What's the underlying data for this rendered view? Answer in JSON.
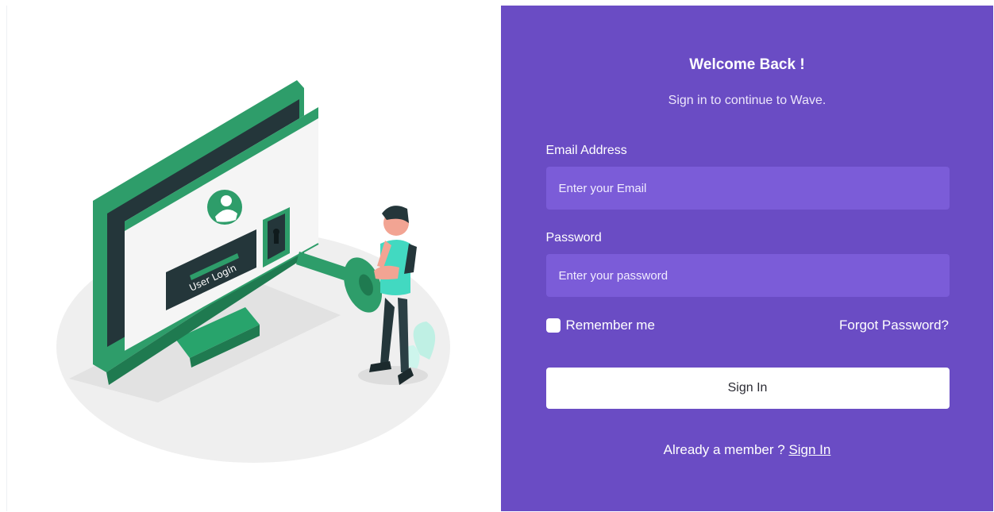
{
  "illustration": {
    "screen_label": "User Login",
    "colors": {
      "green": "#2e9d6a",
      "green_dark": "#1f6e4a",
      "ground": "#efefef",
      "accent_teal": "#42d9c1"
    }
  },
  "form": {
    "title": "Welcome Back !",
    "subtitle": "Sign in to continue to Wave.",
    "email": {
      "label": "Email Address",
      "placeholder": "Enter your Email",
      "value": ""
    },
    "password": {
      "label": "Password",
      "placeholder": "Enter your password",
      "value": ""
    },
    "remember_label": "Remember me",
    "remember_checked": false,
    "forgot_label": "Forgot Password?",
    "submit_label": "Sign In",
    "member_text": "Already a member ?",
    "member_link": "Sign In"
  },
  "colors": {
    "panel": "#6a4cc4",
    "input_bg": "#7b5cd8",
    "button_bg": "#ffffff"
  }
}
